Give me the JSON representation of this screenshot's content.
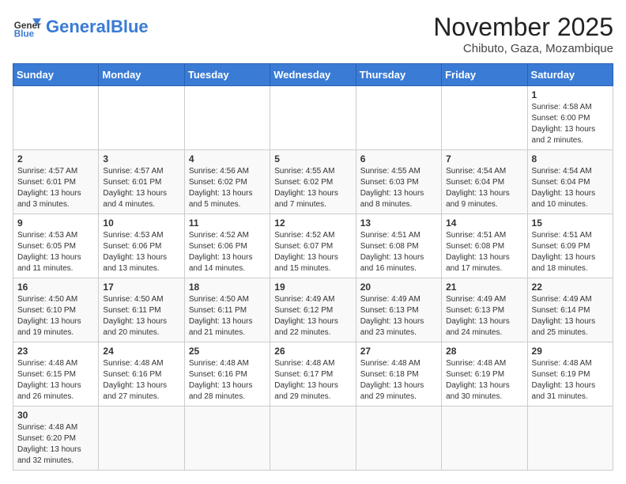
{
  "logo": {
    "general": "General",
    "blue": "Blue"
  },
  "header": {
    "month": "November 2025",
    "location": "Chibuto, Gaza, Mozambique"
  },
  "weekdays": [
    "Sunday",
    "Monday",
    "Tuesday",
    "Wednesday",
    "Thursday",
    "Friday",
    "Saturday"
  ],
  "weeks": [
    [
      {
        "day": "",
        "info": ""
      },
      {
        "day": "",
        "info": ""
      },
      {
        "day": "",
        "info": ""
      },
      {
        "day": "",
        "info": ""
      },
      {
        "day": "",
        "info": ""
      },
      {
        "day": "",
        "info": ""
      },
      {
        "day": "1",
        "info": "Sunrise: 4:58 AM\nSunset: 6:00 PM\nDaylight: 13 hours and 2 minutes."
      }
    ],
    [
      {
        "day": "2",
        "info": "Sunrise: 4:57 AM\nSunset: 6:01 PM\nDaylight: 13 hours and 3 minutes."
      },
      {
        "day": "3",
        "info": "Sunrise: 4:57 AM\nSunset: 6:01 PM\nDaylight: 13 hours and 4 minutes."
      },
      {
        "day": "4",
        "info": "Sunrise: 4:56 AM\nSunset: 6:02 PM\nDaylight: 13 hours and 5 minutes."
      },
      {
        "day": "5",
        "info": "Sunrise: 4:55 AM\nSunset: 6:02 PM\nDaylight: 13 hours and 7 minutes."
      },
      {
        "day": "6",
        "info": "Sunrise: 4:55 AM\nSunset: 6:03 PM\nDaylight: 13 hours and 8 minutes."
      },
      {
        "day": "7",
        "info": "Sunrise: 4:54 AM\nSunset: 6:04 PM\nDaylight: 13 hours and 9 minutes."
      },
      {
        "day": "8",
        "info": "Sunrise: 4:54 AM\nSunset: 6:04 PM\nDaylight: 13 hours and 10 minutes."
      }
    ],
    [
      {
        "day": "9",
        "info": "Sunrise: 4:53 AM\nSunset: 6:05 PM\nDaylight: 13 hours and 11 minutes."
      },
      {
        "day": "10",
        "info": "Sunrise: 4:53 AM\nSunset: 6:06 PM\nDaylight: 13 hours and 13 minutes."
      },
      {
        "day": "11",
        "info": "Sunrise: 4:52 AM\nSunset: 6:06 PM\nDaylight: 13 hours and 14 minutes."
      },
      {
        "day": "12",
        "info": "Sunrise: 4:52 AM\nSunset: 6:07 PM\nDaylight: 13 hours and 15 minutes."
      },
      {
        "day": "13",
        "info": "Sunrise: 4:51 AM\nSunset: 6:08 PM\nDaylight: 13 hours and 16 minutes."
      },
      {
        "day": "14",
        "info": "Sunrise: 4:51 AM\nSunset: 6:08 PM\nDaylight: 13 hours and 17 minutes."
      },
      {
        "day": "15",
        "info": "Sunrise: 4:51 AM\nSunset: 6:09 PM\nDaylight: 13 hours and 18 minutes."
      }
    ],
    [
      {
        "day": "16",
        "info": "Sunrise: 4:50 AM\nSunset: 6:10 PM\nDaylight: 13 hours and 19 minutes."
      },
      {
        "day": "17",
        "info": "Sunrise: 4:50 AM\nSunset: 6:11 PM\nDaylight: 13 hours and 20 minutes."
      },
      {
        "day": "18",
        "info": "Sunrise: 4:50 AM\nSunset: 6:11 PM\nDaylight: 13 hours and 21 minutes."
      },
      {
        "day": "19",
        "info": "Sunrise: 4:49 AM\nSunset: 6:12 PM\nDaylight: 13 hours and 22 minutes."
      },
      {
        "day": "20",
        "info": "Sunrise: 4:49 AM\nSunset: 6:13 PM\nDaylight: 13 hours and 23 minutes."
      },
      {
        "day": "21",
        "info": "Sunrise: 4:49 AM\nSunset: 6:13 PM\nDaylight: 13 hours and 24 minutes."
      },
      {
        "day": "22",
        "info": "Sunrise: 4:49 AM\nSunset: 6:14 PM\nDaylight: 13 hours and 25 minutes."
      }
    ],
    [
      {
        "day": "23",
        "info": "Sunrise: 4:48 AM\nSunset: 6:15 PM\nDaylight: 13 hours and 26 minutes."
      },
      {
        "day": "24",
        "info": "Sunrise: 4:48 AM\nSunset: 6:16 PM\nDaylight: 13 hours and 27 minutes."
      },
      {
        "day": "25",
        "info": "Sunrise: 4:48 AM\nSunset: 6:16 PM\nDaylight: 13 hours and 28 minutes."
      },
      {
        "day": "26",
        "info": "Sunrise: 4:48 AM\nSunset: 6:17 PM\nDaylight: 13 hours and 29 minutes."
      },
      {
        "day": "27",
        "info": "Sunrise: 4:48 AM\nSunset: 6:18 PM\nDaylight: 13 hours and 29 minutes."
      },
      {
        "day": "28",
        "info": "Sunrise: 4:48 AM\nSunset: 6:19 PM\nDaylight: 13 hours and 30 minutes."
      },
      {
        "day": "29",
        "info": "Sunrise: 4:48 AM\nSunset: 6:19 PM\nDaylight: 13 hours and 31 minutes."
      }
    ],
    [
      {
        "day": "30",
        "info": "Sunrise: 4:48 AM\nSunset: 6:20 PM\nDaylight: 13 hours and 32 minutes."
      },
      {
        "day": "",
        "info": ""
      },
      {
        "day": "",
        "info": ""
      },
      {
        "day": "",
        "info": ""
      },
      {
        "day": "",
        "info": ""
      },
      {
        "day": "",
        "info": ""
      },
      {
        "day": "",
        "info": ""
      }
    ]
  ]
}
